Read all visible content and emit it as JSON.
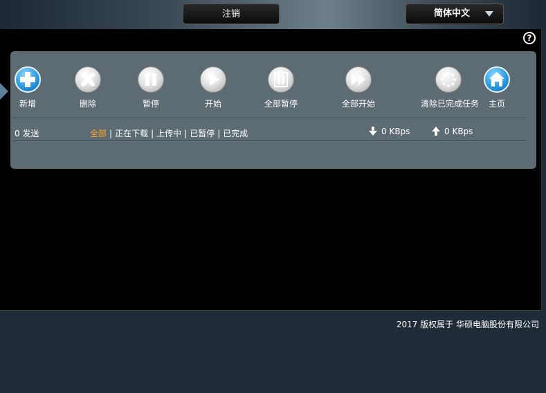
{
  "header": {
    "logout_label": "注销",
    "language_selected": "简体中文"
  },
  "toolbar": {
    "add_label": "新增",
    "delete_label": "删除",
    "pause_label": "暂停",
    "start_label": "开始",
    "pause_all_label": "全部暂停",
    "start_all_label": "全部开始",
    "clear_completed_label": "清除已完成任务",
    "home_label": "主页"
  },
  "status": {
    "sending": "0 发送",
    "download_speed": "0 KBps",
    "upload_speed": "0 KBps"
  },
  "filters": [
    "全部",
    "正在下载",
    "上传中",
    "已暂停",
    "已完成"
  ],
  "footer": {
    "copyright": "2017 版权属于 华硕电脑股份有限公司"
  },
  "colors": {
    "accent_active_filter": "#ffa21a",
    "panel_bg": "#5d6b72",
    "page_bg": "#1f2c38"
  },
  "icons": [
    "help-icon",
    "add-icon",
    "delete-icon",
    "pause-icon",
    "play-icon",
    "pause-all-icon",
    "start-all-icon",
    "clear-completed-icon",
    "home-icon",
    "download-arrow-icon",
    "upload-arrow-icon",
    "chevron-down-icon"
  ]
}
